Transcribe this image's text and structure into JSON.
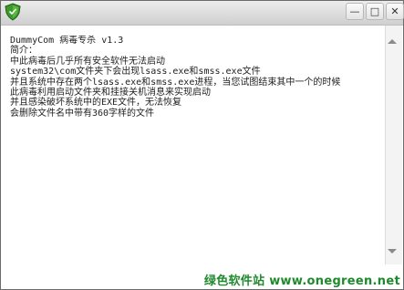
{
  "window": {
    "title": "",
    "controls": {
      "minimize_glyph": "—",
      "maximize_glyph": "□",
      "close_glyph": "✕"
    }
  },
  "content": {
    "lines": [
      "DummyCom 病毒专杀 v1.3",
      "简介：",
      "中此病毒后几乎所有安全软件无法启动",
      "system32\\com文件夹下会出现lsass.exe和smss.exe文件",
      "并且系统中存在两个lsass.exe和smss.exe进程，当您试图结束其中一个的时候",
      "此病毒利用启动文件夹和挂接关机消息来实现启动",
      "并且感染破坏系统中的EXE文件，无法恢复",
      "会删除文件名中带有360字样的文件"
    ]
  },
  "watermark": {
    "text": "绿色软件站 www.onegreen.net"
  },
  "colors": {
    "watermark": "#1f8a2c",
    "icon_green": "#3a9a2a"
  },
  "icons": {
    "app": "shield-icon",
    "scroll_up": "arrow-up-icon",
    "scroll_down": "arrow-down-icon"
  }
}
